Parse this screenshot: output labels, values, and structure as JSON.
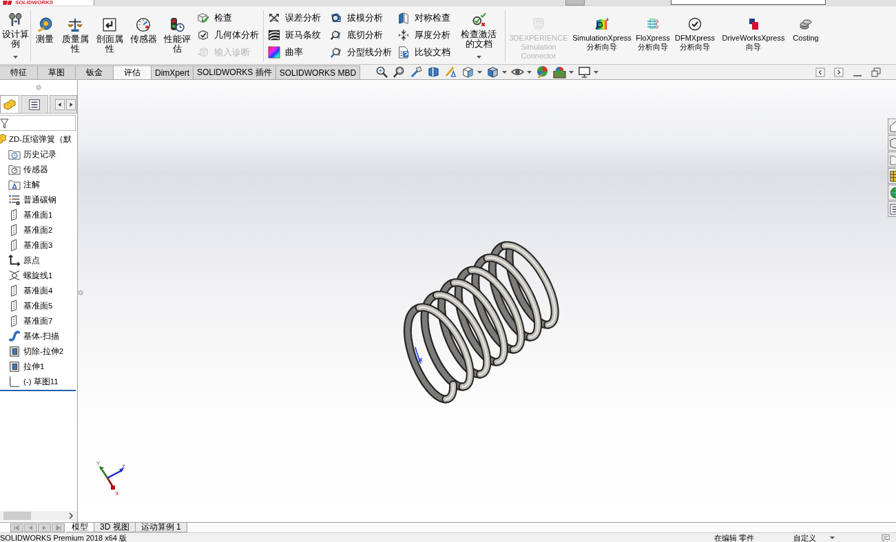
{
  "title_bar": {
    "logo": "SOLIDWORKS"
  },
  "ribbon": {
    "groups": [
      {
        "columns": [
          {
            "kind": "large",
            "label": "设计算例",
            "disabled": false,
            "dropdown": true
          }
        ]
      },
      {
        "columns": [
          {
            "kind": "large",
            "label": "测量",
            "disabled": false,
            "dropdown": false
          },
          {
            "kind": "large",
            "label": "质量属性",
            "disabled": false,
            "dropdown": false
          },
          {
            "kind": "large",
            "label": "剖面属性",
            "disabled": false,
            "dropdown": false
          },
          {
            "kind": "large",
            "label": "传感器",
            "disabled": false,
            "dropdown": false
          },
          {
            "kind": "large",
            "label": "性能评估",
            "disabled": false,
            "dropdown": false
          },
          {
            "kind": "stack",
            "items": [
              {
                "label": "检查",
                "disabled": false
              },
              {
                "label": "几何体分析",
                "disabled": false
              },
              {
                "label": "输入诊断",
                "disabled": true
              }
            ]
          }
        ]
      },
      {
        "columns": [
          {
            "kind": "stack",
            "items": [
              {
                "label": "误差分析",
                "disabled": false
              },
              {
                "label": "斑马条纹",
                "disabled": false
              },
              {
                "label": "曲率",
                "disabled": false
              }
            ]
          },
          {
            "kind": "stack",
            "items": [
              {
                "label": "拔模分析",
                "disabled": false
              },
              {
                "label": "底切分析",
                "disabled": false
              },
              {
                "label": "分型线分析",
                "disabled": false
              }
            ]
          },
          {
            "kind": "stack",
            "items": [
              {
                "label": "对称检查",
                "disabled": false
              },
              {
                "label": "厚度分析",
                "disabled": false
              },
              {
                "label": "比较文档",
                "disabled": false
              }
            ]
          },
          {
            "kind": "large",
            "label": "检查激活的文档",
            "disabled": false,
            "dropdown": true
          }
        ]
      },
      {
        "columns": [
          {
            "kind": "wide",
            "label": "3DEXPERIENCE Simulation Connector",
            "disabled": true,
            "dropdown": false
          },
          {
            "kind": "wide",
            "label": "SimulationXpress 分析向导",
            "disabled": false,
            "dropdown": false
          },
          {
            "kind": "wide",
            "label": "FloXpress 分析向导",
            "disabled": false,
            "dropdown": false
          },
          {
            "kind": "wide",
            "label": "DFMXpress 分析向导",
            "disabled": false,
            "dropdown": false
          },
          {
            "kind": "wide",
            "label": "DriveWorksXpress 向导",
            "disabled": false,
            "dropdown": false
          },
          {
            "kind": "wide",
            "label": "Costing",
            "disabled": false,
            "dropdown": false
          }
        ]
      }
    ]
  },
  "command_tabs": [
    {
      "label": "特征",
      "selected": false
    },
    {
      "label": "草图",
      "selected": false
    },
    {
      "label": "钣金",
      "selected": false
    },
    {
      "label": "评估",
      "selected": true
    },
    {
      "label": "DimXpert",
      "selected": false
    },
    {
      "label": "SOLIDWORKS 插件",
      "selected": false
    },
    {
      "label": "SOLIDWORKS MBD",
      "selected": false
    }
  ],
  "panel_tabs": [
    {
      "selected": true
    },
    {
      "selected": false
    },
    {
      "selected": false
    }
  ],
  "feature_tree": {
    "root": {
      "kind": "part",
      "label": "ZD-压缩弹簧（默",
      "children": [
        {
          "kind": "history",
          "label": "历史记录"
        },
        {
          "kind": "sensors",
          "label": "传感器"
        },
        {
          "kind": "annotations",
          "label": "注解"
        },
        {
          "kind": "material",
          "label": "普通碳钢"
        },
        {
          "kind": "plane",
          "label": "基准面1"
        },
        {
          "kind": "plane",
          "label": "基准面2"
        },
        {
          "kind": "plane",
          "label": "基准面3"
        },
        {
          "kind": "origin",
          "label": "原点"
        },
        {
          "kind": "helix",
          "label": "螺旋线1"
        },
        {
          "kind": "plane",
          "label": "基准面4"
        },
        {
          "kind": "plane",
          "label": "基准面5"
        },
        {
          "kind": "plane",
          "label": "基准面7"
        },
        {
          "kind": "sweep",
          "label": "基体-扫描"
        },
        {
          "kind": "cut_extrude",
          "label": "切除-拉伸2"
        },
        {
          "kind": "extrude",
          "label": "拉伸1"
        },
        {
          "kind": "sketch",
          "label": "(-) 草图11"
        }
      ]
    }
  },
  "triad": {
    "x_label": "X",
    "y_label": "Y",
    "z_label": "Z"
  },
  "document_tabs": [
    {
      "label": "模型",
      "selected": true
    },
    {
      "label": "3D 视图",
      "selected": false
    },
    {
      "label": "运动算例 1",
      "selected": false
    }
  ],
  "status_bar": {
    "product": "SOLIDWORKS Premium 2018 x64 版",
    "edit_mode": "在编辑 零件",
    "units": "自定义"
  }
}
